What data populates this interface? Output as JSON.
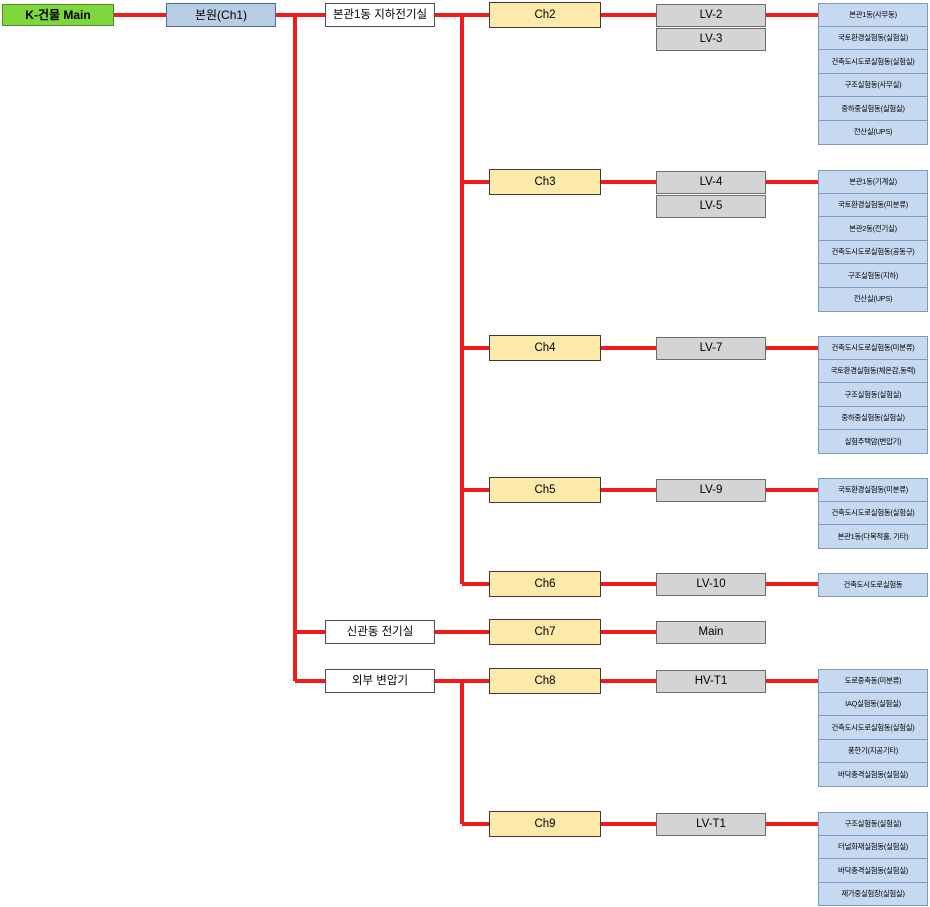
{
  "diagram": {
    "title": "K-건물 전기 계통도",
    "colors": {
      "wire": "#EE1C1C",
      "root": "#7DD63C",
      "main": "#B8CCE4",
      "location": "#FFFFFF",
      "channel": "#FDE9A9",
      "panel": "#D4D4D4",
      "leaf": "#C6D9F0"
    },
    "root": {
      "label": "K-건물 Main"
    },
    "main": {
      "label": "본원(Ch1)"
    },
    "locations": [
      {
        "label": "본관1동 지하전기실"
      },
      {
        "label": "신관동 전기실"
      },
      {
        "label": "외부 변압기"
      }
    ],
    "channels": [
      {
        "label": "Ch2"
      },
      {
        "label": "Ch3"
      },
      {
        "label": "Ch4"
      },
      {
        "label": "Ch5"
      },
      {
        "label": "Ch6"
      },
      {
        "label": "Ch7"
      },
      {
        "label": "Ch8"
      },
      {
        "label": "Ch9"
      }
    ],
    "panels": [
      {
        "label": "LV-2"
      },
      {
        "label": "LV-3"
      },
      {
        "label": "LV-4"
      },
      {
        "label": "LV-5"
      },
      {
        "label": "LV-7"
      },
      {
        "label": "LV-9"
      },
      {
        "label": "LV-10"
      },
      {
        "label": "Main"
      },
      {
        "label": "HV-T1"
      },
      {
        "label": "LV-T1"
      }
    ],
    "leaf_groups": [
      {
        "parent": "LV-2",
        "items": [
          {
            "label": "본관1동(사무동)"
          },
          {
            "label": "국토환경실험동(실험실)"
          },
          {
            "label": "건축도시도로실험동(실험실)"
          },
          {
            "label": "구조실험동(사무실)"
          },
          {
            "label": "중하중실험동(실험실)"
          },
          {
            "label": "전산실(UPS)"
          }
        ]
      },
      {
        "parent": "LV-4",
        "items": [
          {
            "label": "본관1동(기계실)"
          },
          {
            "label": "국토환경실험동(미분류)"
          },
          {
            "label": "본관2동(전기실)"
          },
          {
            "label": "건축도시도로실험동(공동구)"
          },
          {
            "label": "구조실험동(지하)"
          },
          {
            "label": "전산실(UPS)"
          }
        ]
      },
      {
        "parent": "LV-7",
        "items": [
          {
            "label": "건축도시도로실험동(미분류)"
          },
          {
            "label": "국토환경실험동(체온감,동력)"
          },
          {
            "label": "구조실험동(실험실)"
          },
          {
            "label": "중하중실험동(실험실)"
          },
          {
            "label": "실험주택암(변압기)"
          }
        ]
      },
      {
        "parent": "LV-9",
        "items": [
          {
            "label": "국토환경실험동(미분류)"
          },
          {
            "label": "건축도시도로실험동(실험실)"
          },
          {
            "label": "본관1동(다목적홀, 기타)"
          }
        ]
      },
      {
        "parent": "LV-10",
        "items": [
          {
            "label": "건축도시도로실험동"
          }
        ]
      },
      {
        "parent": "HV-T1",
        "items": [
          {
            "label": "도로중축동(미분류)"
          },
          {
            "label": "IAQ실험동(실험실)"
          },
          {
            "label": "건축도시도로실험동(실험실)"
          },
          {
            "label": "풍한기(지공기타)"
          },
          {
            "label": "바닥충격실험동(실험실)"
          }
        ]
      },
      {
        "parent": "LV-T1",
        "items": [
          {
            "label": "구조실험동(실험실)"
          },
          {
            "label": "터널화재실험동(실험실)"
          },
          {
            "label": "바닥충격실험동(실험실)"
          },
          {
            "label": "재가중실험장(실험실)"
          }
        ]
      }
    ]
  }
}
